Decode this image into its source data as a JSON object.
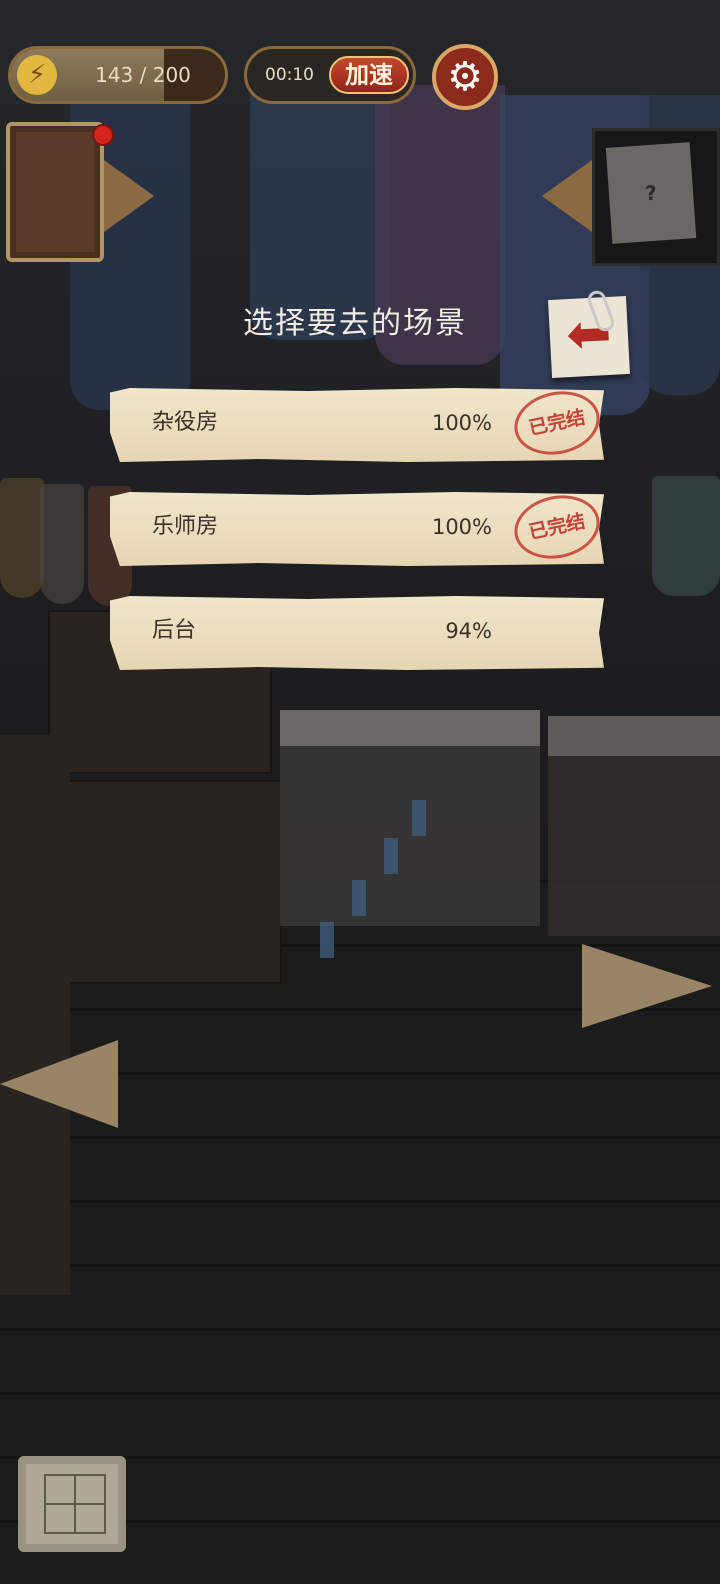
{
  "hud": {
    "energy_text": "143 / 200",
    "energy_fraction": 0.715,
    "timer": "00:10",
    "speed_label": "加速",
    "lightning_icon": "⚡",
    "settings_icon": "gear-icon"
  },
  "dialog": {
    "title": "选择要去的场景",
    "back_icon": "back-arrow-icon",
    "scenes": [
      {
        "name": "杂役房",
        "progress": "100%",
        "stamp": "已完结"
      },
      {
        "name": "乐师房",
        "progress": "100%",
        "stamp": "已完结"
      },
      {
        "name": "后台",
        "progress": "94%",
        "stamp": ""
      }
    ]
  },
  "colors": {
    "accent": "#8c2a1c",
    "frame_gold": "#8a6a3c",
    "paper": "#f1e6cb",
    "stamp_red": "#be3228"
  }
}
